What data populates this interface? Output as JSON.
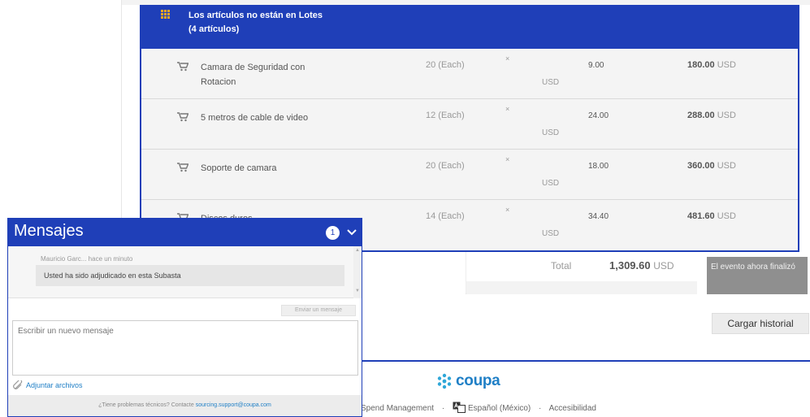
{
  "lot": {
    "title_line1": "Los artículos no están en Lotes",
    "title_line2": "(4 artículos)",
    "items": [
      {
        "name": "Camara de Seguridad con Rotacion",
        "qty": "20 (Each)",
        "times": "×",
        "unit_currency": "USD",
        "price": "9.00",
        "ext_value": "180.00",
        "ext_currency": "USD"
      },
      {
        "name": "5 metros de cable de video",
        "qty": "12 (Each)",
        "times": "×",
        "unit_currency": "USD",
        "price": "24.00",
        "ext_value": "288.00",
        "ext_currency": "USD"
      },
      {
        "name": "Soporte de camara",
        "qty": "20 (Each)",
        "times": "×",
        "unit_currency": "USD",
        "price": "18.00",
        "ext_value": "360.00",
        "ext_currency": "USD"
      },
      {
        "name": "Discos duros",
        "qty": "14 (Each)",
        "times": "×",
        "unit_currency": "USD",
        "price": "34.40",
        "ext_value": "481.60",
        "ext_currency": "USD"
      }
    ]
  },
  "summary": {
    "total_label": "Total",
    "total_value": "1,309.60",
    "total_currency": "USD",
    "event_status": "El evento ahora finalizó",
    "history_button": "Cargar historial"
  },
  "footer": {
    "brand": "coupa",
    "link_spend": "Spend Management",
    "link_language": "Español (México)",
    "link_accessibility": "Accesibilidad",
    "separator": "·"
  },
  "messages": {
    "title": "Mensajes",
    "unread_count": "1",
    "sender_meta": "Mauricio Garc... hace un minuto",
    "message_text": "Usted ha sido adjudicado en esta Subasta",
    "send_button": "Enviar un mensaje",
    "new_message_placeholder": "Escribir un nuevo mensaje",
    "attach_label": "Adjuntar archivos",
    "support_text": "¿Tiene problemas técnicos? Contacte",
    "support_email": "sourcing.support@coupa.com"
  },
  "colors": {
    "primary_blue": "#1f3fb8",
    "link_blue": "#1f7fc6",
    "status_gray": "#8f8f8f"
  }
}
